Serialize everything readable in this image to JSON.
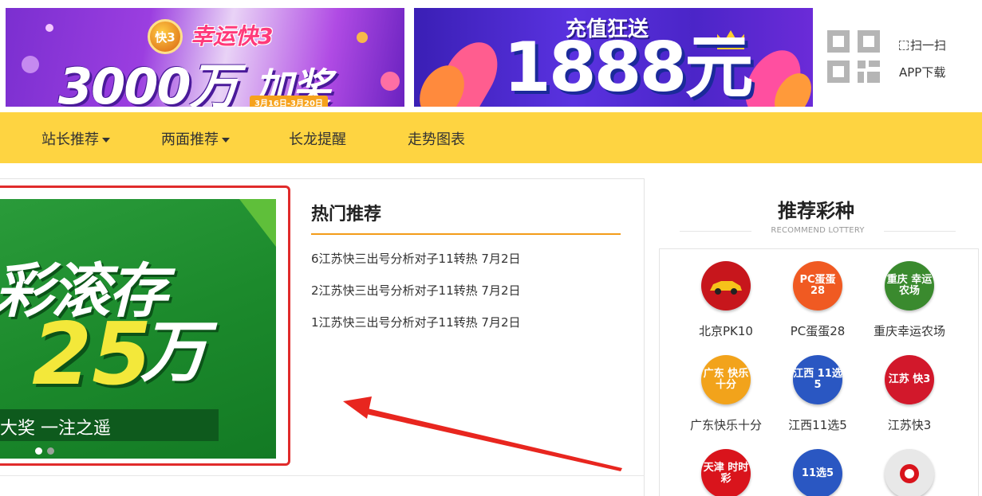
{
  "banner_left": {
    "badge": "快3",
    "subtitle": "幸运快3",
    "headline": "3000万",
    "headline_suffix": "加奖",
    "date": "3月16日-3月20日"
  },
  "banner_right": {
    "top_text": "充值狂送",
    "headline": "1888元"
  },
  "qr": {
    "scan_label": "扫一扫",
    "app_download": "APP下载"
  },
  "nav": {
    "items": [
      {
        "label": "站长推荐",
        "has_dropdown": true
      },
      {
        "label": "两面推荐",
        "has_dropdown": true
      },
      {
        "label": "长龙提醒",
        "has_dropdown": false
      },
      {
        "label": "走势图表",
        "has_dropdown": false
      }
    ]
  },
  "carousel": {
    "line1": "彩滚存",
    "number": "25",
    "unit": "万",
    "slogan": "大奖 一注之遥"
  },
  "hot": {
    "title": "热门推荐",
    "items": [
      "6江苏快三出号分析对子11转热 7月2日",
      "2江苏快三出号分析对子11转热 7月2日",
      "1江苏快三出号分析对子11转热 7月2日"
    ]
  },
  "recommend": {
    "title": "推荐彩种",
    "subtitle": "RECOMMEND LOTTERY",
    "lotteries": [
      {
        "name": "北京PK10",
        "icon": "race-car-icon",
        "color": "#c7161c",
        "icon_text": ""
      },
      {
        "name": "PC蛋蛋28",
        "icon": "pc-egg-28-icon",
        "color": "#f05a22",
        "icon_text": "PC蛋蛋 28"
      },
      {
        "name": "重庆幸运农场",
        "icon": "farm-icon",
        "color": "#3a8a2e",
        "icon_text": "重庆 幸运农场"
      },
      {
        "name": "广东快乐十分",
        "icon": "happy-ten-icon",
        "color": "#f2a31b",
        "icon_text": "广东 快乐十分"
      },
      {
        "name": "江西11选5",
        "icon": "jiangxi-11x5-icon",
        "color": "#2a57c2",
        "icon_text": "江西 11选5"
      },
      {
        "name": "江苏快3",
        "icon": "jiangsu-k3-icon",
        "color": "#d2182b",
        "icon_text": "江苏 快3"
      },
      {
        "name": "",
        "icon": "tianjin-ssc-icon",
        "color": "#d9141c",
        "icon_text": "天津 时时彩"
      },
      {
        "name": "",
        "icon": "11x5-icon",
        "color": "#2a57c2",
        "icon_text": "11选5"
      },
      {
        "name": "",
        "icon": "lottery-ball-icon",
        "color": "#e8e8e8",
        "icon_text": ""
      }
    ]
  }
}
